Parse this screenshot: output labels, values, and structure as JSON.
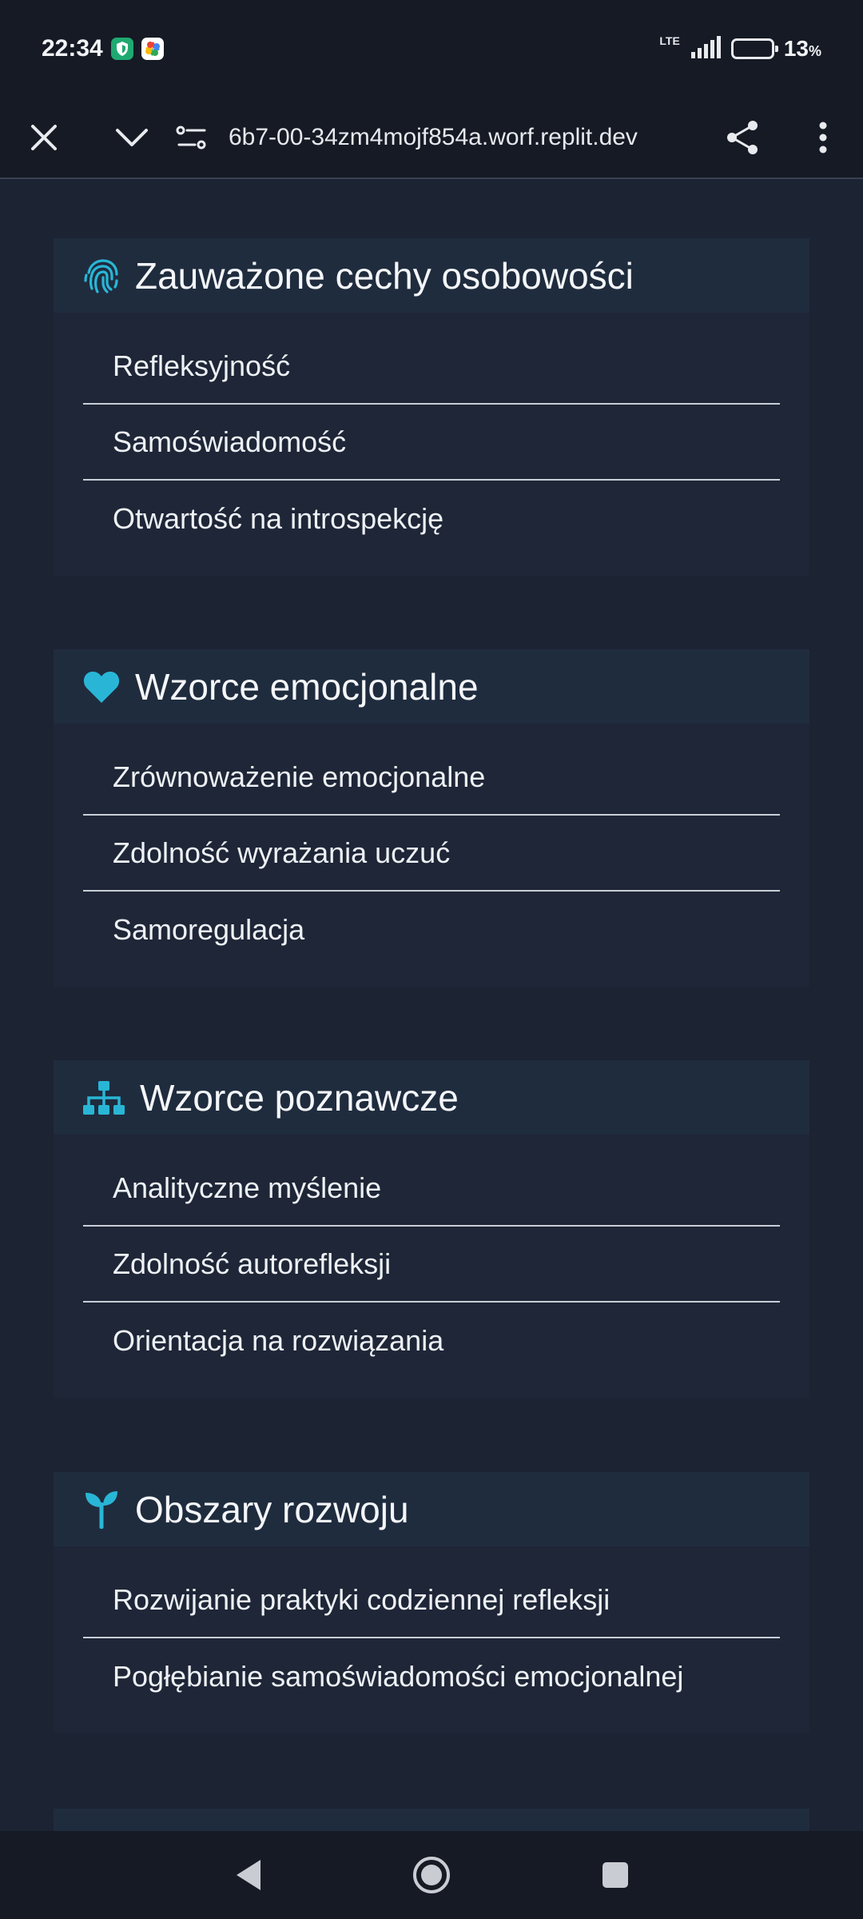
{
  "status_bar": {
    "time": "22:34",
    "network": "LTE",
    "battery_percent": "13",
    "battery_unit": "%"
  },
  "browser": {
    "url": "6b7-00-34zm4mojf854a.worf.replit.dev"
  },
  "sections": [
    {
      "icon": "fingerprint-icon",
      "title": "Zauważone cechy osobowości",
      "items": [
        "Refleksyjność",
        "Samoświadomość",
        "Otwartość na introspekcję"
      ]
    },
    {
      "icon": "heart-icon",
      "title": "Wzorce emocjonalne",
      "items": [
        "Zrównoważenie emocjonalne",
        "Zdolność wyrażania uczuć",
        "Samoregulacja"
      ]
    },
    {
      "icon": "sitemap-icon",
      "title": "Wzorce poznawcze",
      "items": [
        "Analityczne myślenie",
        "Zdolność autorefleksji",
        "Orientacja na rozwiązania"
      ]
    },
    {
      "icon": "seedling-icon",
      "title": "Obszary rozwoju",
      "items": [
        "Rozwijanie praktyki codziennej refleksji",
        "Pogłębianie samoświadomości emocjonalnej"
      ]
    }
  ],
  "colors": {
    "accent": "#29b6d6",
    "background": "#1c2333",
    "card": "#1e2637",
    "card_header": "#1f2c3e"
  }
}
